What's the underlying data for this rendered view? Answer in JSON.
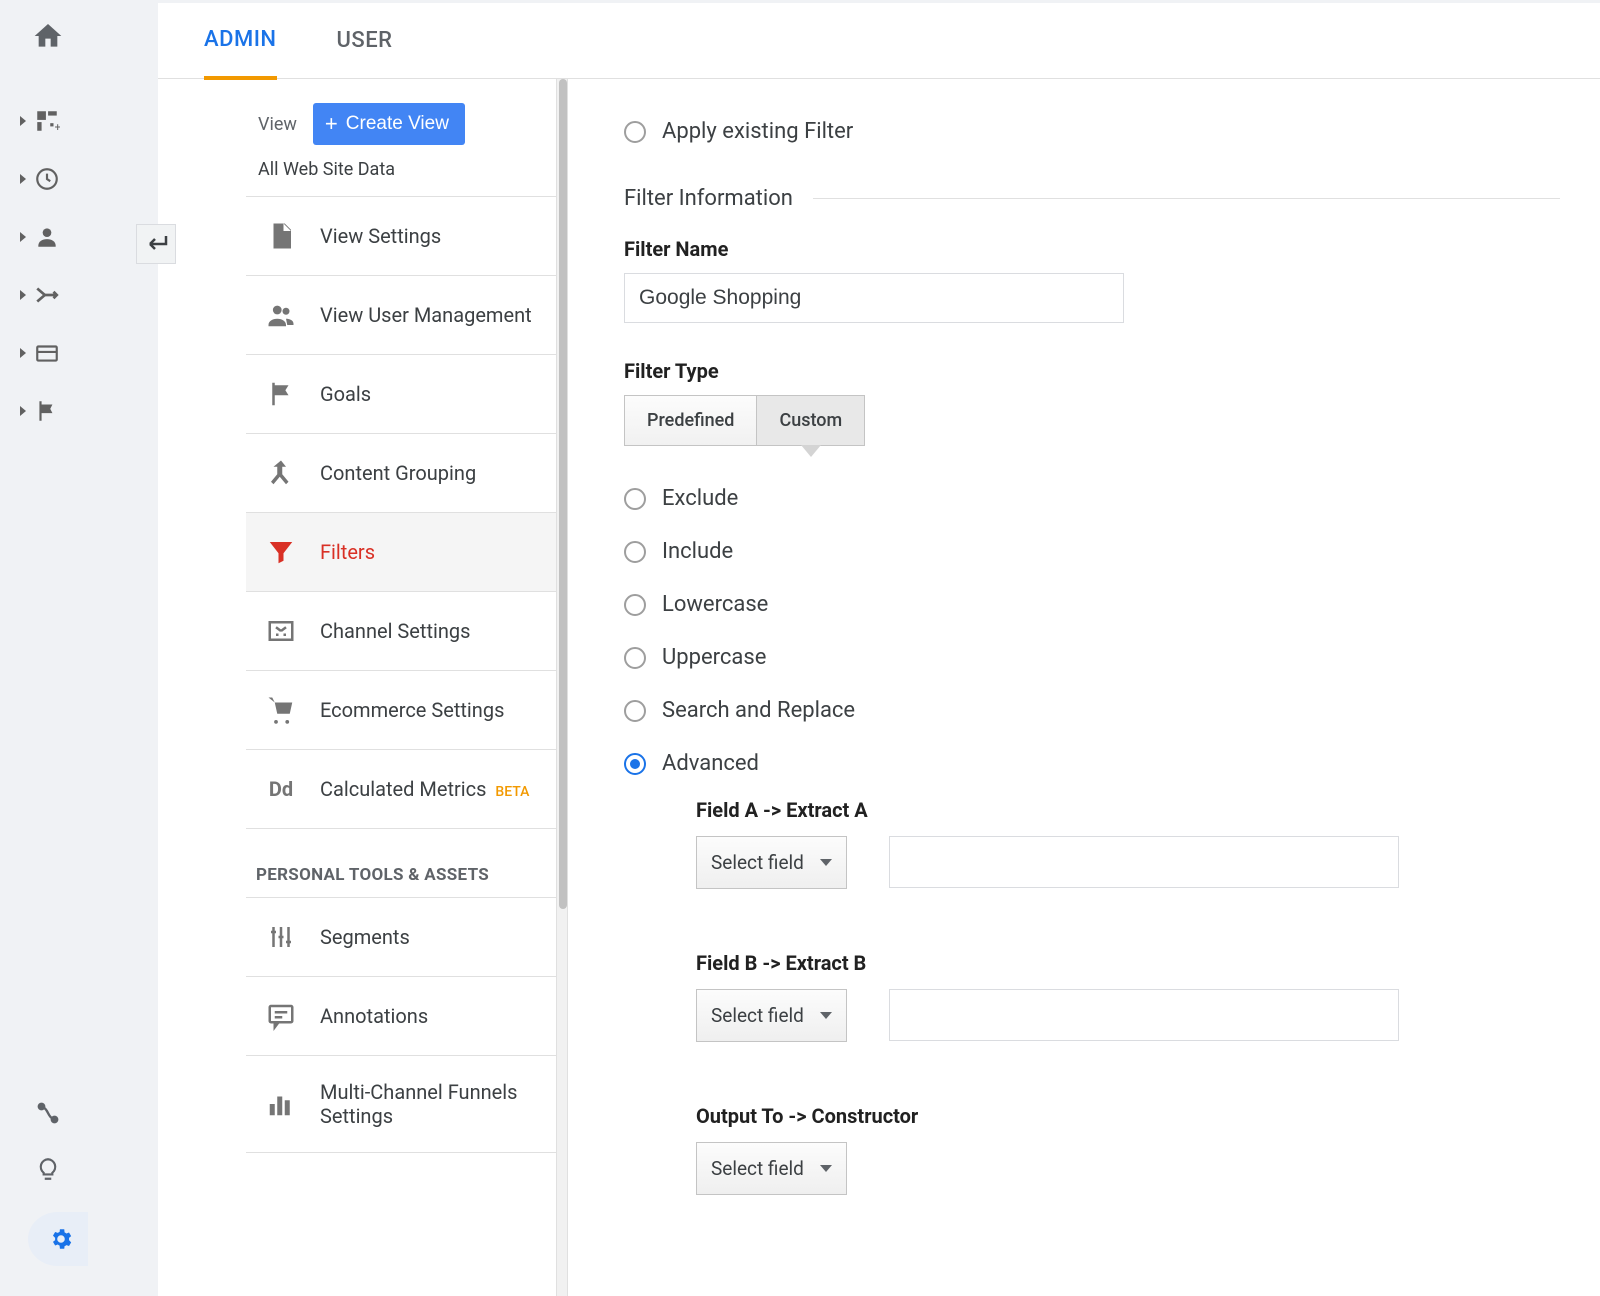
{
  "tabs": {
    "admin": "ADMIN",
    "user": "USER"
  },
  "view": {
    "label": "View",
    "create_label": "Create View",
    "name": "All Web Site Data"
  },
  "menu": {
    "view_settings": "View Settings",
    "user_mgmt": "View User Management",
    "goals": "Goals",
    "content_grouping": "Content Grouping",
    "filters": "Filters",
    "channel_settings": "Channel Settings",
    "ecommerce": "Ecommerce Settings",
    "calc_metrics": "Calculated Metrics",
    "beta": "BETA",
    "section": "PERSONAL TOOLS & ASSETS",
    "segments": "Segments",
    "annotations": "Annotations",
    "mcf": "Multi-Channel Funnels Settings"
  },
  "form": {
    "apply_existing": "Apply existing Filter",
    "section_title": "Filter Information",
    "name_label": "Filter Name",
    "name_value": "Google Shopping",
    "type_label": "Filter Type",
    "predefined": "Predefined",
    "custom": "Custom",
    "radios": {
      "exclude": "Exclude",
      "include": "Include",
      "lowercase": "Lowercase",
      "uppercase": "Uppercase",
      "search_replace": "Search and Replace",
      "advanced": "Advanced"
    },
    "adv": {
      "field_a": "Field A -> Extract A",
      "field_b": "Field B -> Extract B",
      "output": "Output To -> Constructor",
      "select_field": "Select field"
    }
  }
}
